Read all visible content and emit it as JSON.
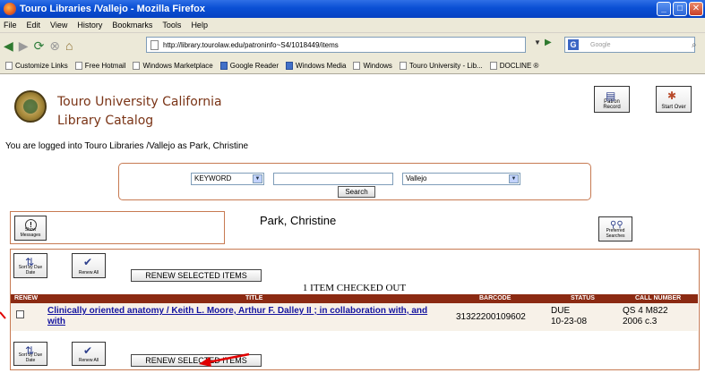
{
  "window": {
    "title": "Touro Libraries /Vallejo - Mozilla Firefox",
    "controls": {
      "minimize": "_",
      "maximize": "□",
      "close": "✕"
    }
  },
  "menubar": [
    "File",
    "Edit",
    "View",
    "History",
    "Bookmarks",
    "Tools",
    "Help"
  ],
  "toolbar": {
    "url": "http://library.tourolaw.edu/patroninfo~S4/1018449/items",
    "search_engine_badge": "G",
    "search_placeholder": "Google"
  },
  "bookmarks": [
    "Customize Links",
    "Free Hotmail",
    "Windows Marketplace",
    "Google Reader",
    "Windows Media",
    "Windows",
    "Touro University - Lib...",
    "DOCLINE ®"
  ],
  "header": {
    "brand_line1": "Touro University California",
    "brand_line2": "Library Catalog",
    "patron_record_label": "Patron Record",
    "start_over_label": "Start Over"
  },
  "logged_in_text": "You are logged into Touro Libraries /Vallejo as Park, Christine",
  "search": {
    "type_selected": "KEYWORD",
    "query": "",
    "scope_selected": "Vallejo",
    "button_label": "Search"
  },
  "messages": {
    "show_messages_label": "Show Messages",
    "patron_name": "Park, Christine",
    "preferred_searches_label": "Preferred Searches"
  },
  "checkout": {
    "sort_label": "Sort by Due Date",
    "renew_all_label": "Renew All",
    "renew_selected_label": "RENEW SELECTED ITEMS",
    "summary": "1 ITEM CHECKED OUT",
    "columns": [
      "RENEW",
      "TITLE",
      "BARCODE",
      "STATUS",
      "CALL NUMBER"
    ],
    "items": [
      {
        "title": "Clinically oriented anatomy / Keith L. Moore, Arthur F. Dalley II ; in collaboration with, and with",
        "barcode": "31322200109602",
        "status_line1": "DUE",
        "status_line2": "10-23-08",
        "call_line1": "QS 4 M822",
        "call_line2": "2006 c.3"
      }
    ]
  },
  "colors": {
    "panel_border": "#c77a52",
    "header_band": "#8b2a12",
    "brand_text": "#7a3416",
    "link": "#1515a0",
    "annotation_arrow": "#e00000"
  }
}
